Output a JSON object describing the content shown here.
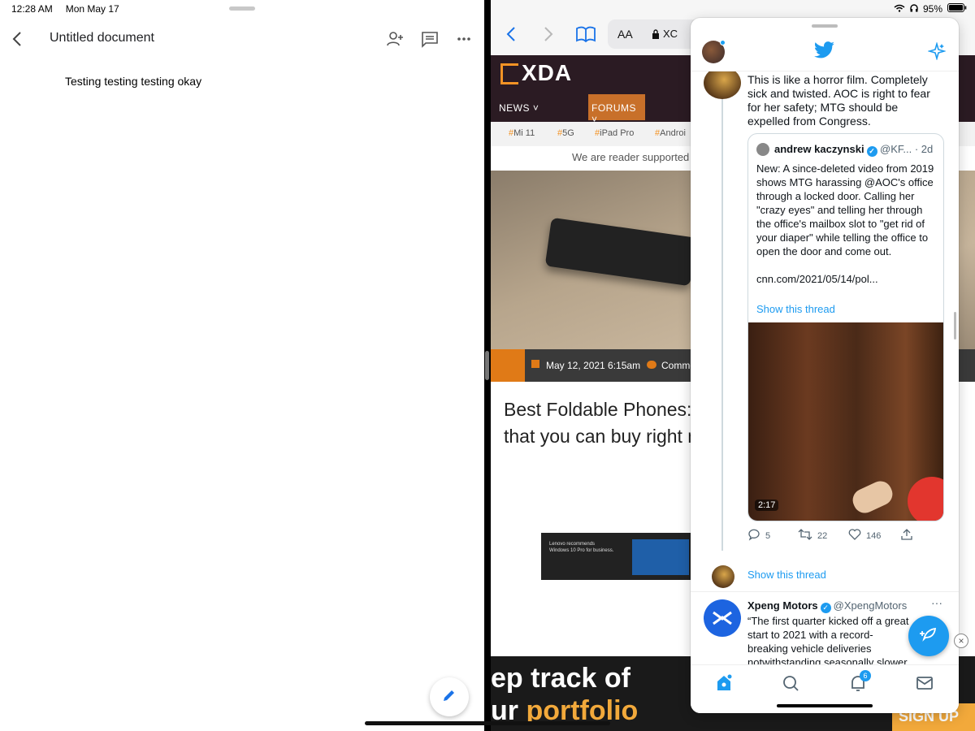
{
  "status": {
    "time": "12:28 AM",
    "date": "Mon May 17",
    "battery": "95%"
  },
  "docs": {
    "title": "Untitled document",
    "body": "Testing testing testing okay",
    "icons": [
      "back-icon",
      "add-person-icon",
      "comment-icon",
      "more-icon",
      "edit-icon"
    ]
  },
  "safari": {
    "aa_label": "AA",
    "domain": "XC",
    "site": {
      "logo": "XDA",
      "nav_news": "NEWS",
      "nav_forums": "FORUMS",
      "tags": [
        "Mi 11",
        "5G",
        "iPad Pro",
        "Androi"
      ],
      "support_text": "We are reader supported",
      "date": "May 12, 2021 6:15am",
      "comments": "Comme",
      "headline": "Best Foldable Phones: \nthat you can buy right n",
      "ad_text": "Lenovo recommends\nWindows 10 Pro for business.",
      "banner_line1": "ep track of",
      "banner_line2_prefix": "ur ",
      "banner_line2_accent": "portfolio",
      "signup": "SIGN UP"
    }
  },
  "twitter": {
    "tweet1_text": "This is like a horror film. Completely sick and twisted. AOC is right to fear for her safety; MTG should be expelled from Congress.",
    "quote": {
      "name": "andrew kaczynski",
      "handle": "@KF... · 2d",
      "body": "New: A since-deleted video from 2019 shows MTG harassing @AOC's office through a locked door. Calling her \"crazy eyes\" and telling her through the office's mailbox slot to \"get rid of your diaper\" while telling the office to open the door and come out.\n\ncnn.com/2021/05/14/pol...",
      "show_thread": "Show this thread",
      "duration": "2:17"
    },
    "actions": {
      "replies": "5",
      "retweets": "22",
      "likes": "146"
    },
    "show_thread2": "Show this thread",
    "tweet2": {
      "name": "Xpeng Motors",
      "handle": "@XpengMotors",
      "more": "···",
      "body": "“The first quarter kicked off a great start to 2021 with a record-breaking vehicle deliveries notwithstanding seasonally slower demand for automobiles and the semiconductor"
    },
    "notifications_badge": "6",
    "accent": "#1d9bf0"
  }
}
